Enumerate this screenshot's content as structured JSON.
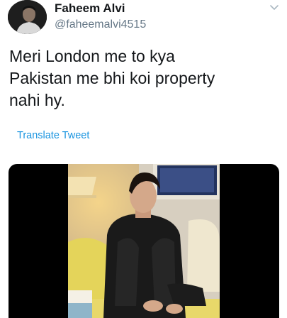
{
  "tweet": {
    "author": {
      "display_name": "Faheem Alvi",
      "handle": "@faheemalvi4515"
    },
    "text": "Meri London me to kya\nPakistan me bhi koi property\nnahi hy.",
    "translate_label": "Translate Tweet",
    "icons": {
      "caret": "chevron-down-icon",
      "avatar": "avatar"
    }
  },
  "colors": {
    "text_primary": "#14171a",
    "text_secondary": "#657786",
    "link": "#1b95e0",
    "media_background": "#000000"
  }
}
